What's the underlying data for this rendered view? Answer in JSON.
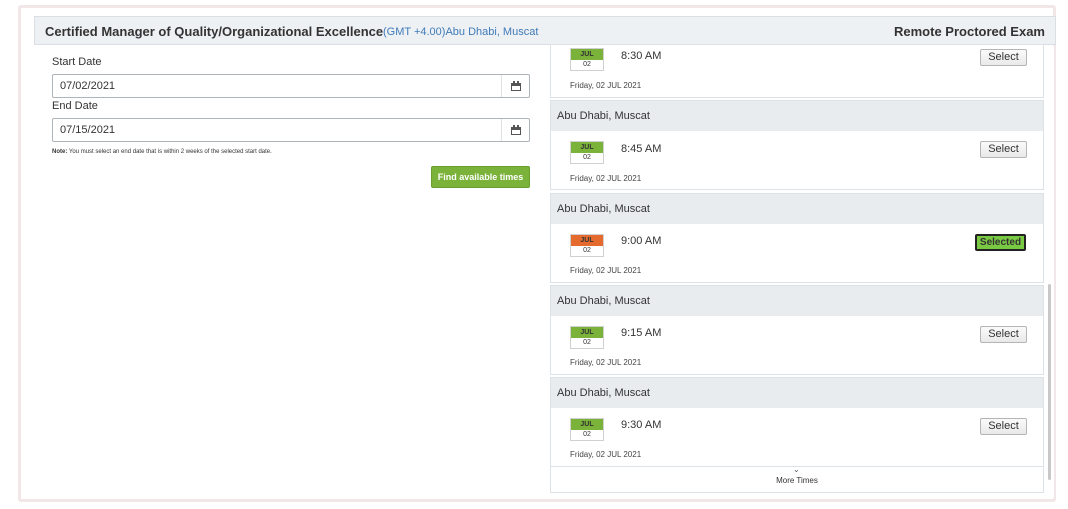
{
  "header": {
    "title": "Certified Manager of Quality/Organizational Excellence",
    "timezone": "(GMT +4.00)Abu Dhabi, Muscat",
    "exam_type": "Remote Proctored Exam"
  },
  "form": {
    "start_label": "Start Date",
    "start_value": "07/02/2021",
    "end_label": "End Date",
    "end_value": "07/15/2021",
    "note_bold": "Note:",
    "note_text": "You must select an end date that is within 2 weeks of the selected start date.",
    "find_button": "Find available times"
  },
  "slots": [
    {
      "location": "",
      "month": "JUL",
      "day": "02",
      "time": "8:30 AM",
      "date_text": "Friday, 02 JUL 2021",
      "button": "Select",
      "selected": false
    },
    {
      "location": "Abu Dhabi, Muscat",
      "month": "JUL",
      "day": "02",
      "time": "8:45 AM",
      "date_text": "Friday, 02 JUL 2021",
      "button": "Select",
      "selected": false
    },
    {
      "location": "Abu Dhabi, Muscat",
      "month": "JUL",
      "day": "02",
      "time": "9:00 AM",
      "date_text": "Friday, 02 JUL 2021",
      "button": "Selected",
      "selected": true
    },
    {
      "location": "Abu Dhabi, Muscat",
      "month": "JUL",
      "day": "02",
      "time": "9:15 AM",
      "date_text": "Friday, 02 JUL 2021",
      "button": "Select",
      "selected": false
    },
    {
      "location": "Abu Dhabi, Muscat",
      "month": "JUL",
      "day": "02",
      "time": "9:30 AM",
      "date_text": "Friday, 02 JUL 2021",
      "button": "Select",
      "selected": false
    }
  ],
  "more_times": "More Times",
  "colors": {
    "accent_green": "#7ab23a",
    "selected_month": "#e46a2e",
    "timezone_blue": "#3f7ab8"
  },
  "icons": {
    "calendar": "calendar-icon",
    "chevron": "chevron-down-icon"
  }
}
